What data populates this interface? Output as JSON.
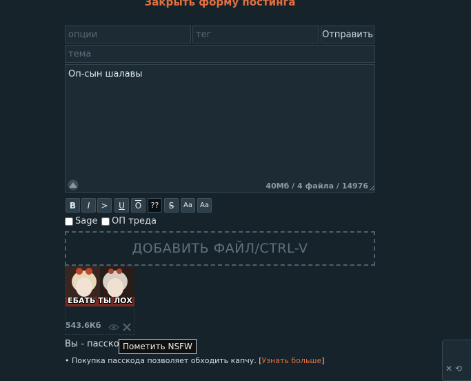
{
  "close_form_link": "Закрыть форму постинга",
  "form": {
    "options_placeholder": "опции",
    "tag_placeholder": "тег",
    "send_label": "Отправить",
    "subject_placeholder": "тема",
    "comment_value": "Оп-сын шалавы",
    "limits_text": "40Мб / 4 файла / 14976"
  },
  "format_buttons": [
    {
      "label": "B",
      "name": "bold-button"
    },
    {
      "label": "I",
      "name": "italic-button"
    },
    {
      "label": ">",
      "name": "quote-button"
    },
    {
      "label": "U",
      "name": "underline-button"
    },
    {
      "label": "O",
      "name": "overline-button"
    },
    {
      "label": "??",
      "name": "spoiler-button"
    },
    {
      "label": "S",
      "name": "strike-button"
    },
    {
      "label": "Aa",
      "name": "superscript-button"
    },
    {
      "label": "Aa",
      "name": "subscript-button"
    }
  ],
  "checkboxes": {
    "sage_label": "Sage",
    "op_label": "ОП треда"
  },
  "dropzone_label": "ДОБАВИТЬ ФАЙЛ/CTRL-V",
  "attachment": {
    "caption": "ЕБАТЬ ТЫ ЛОХ",
    "size": "543.6Кб"
  },
  "tooltip": "Пометить NSFW",
  "passcode": {
    "title": "Вы - пасскод",
    "bullet1_text": "• Покупка пасскода позволяет обходить капчу. [",
    "bullet1_link": "Узнать больше",
    "bullet1_end": "]"
  },
  "colors": {
    "accent": "#e26f3f",
    "background": "#16232b",
    "field": "#1c2b34"
  }
}
